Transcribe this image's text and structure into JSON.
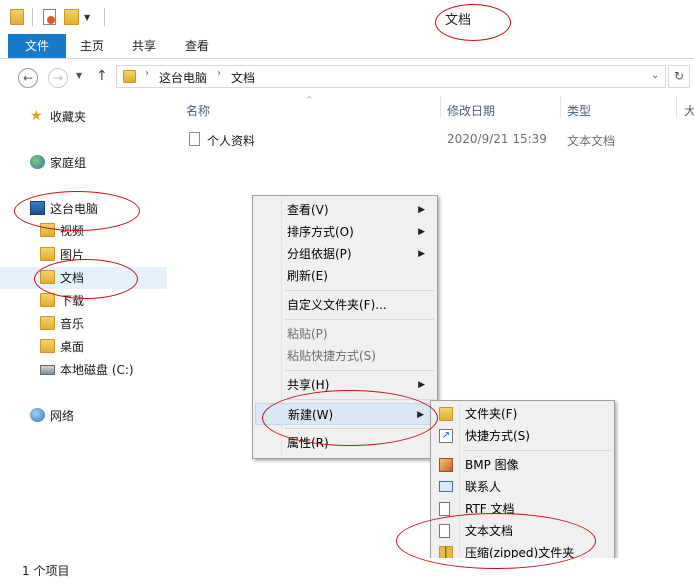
{
  "window": {
    "title": "文档"
  },
  "ribbon": {
    "tabs": [
      "文件",
      "主页",
      "共享",
      "查看"
    ]
  },
  "address": {
    "path": [
      "这台电脑",
      "文档"
    ],
    "refresh_icon": "refresh-icon"
  },
  "nav": {
    "favorites": "收藏夹",
    "homegroup": "家庭组",
    "this_pc": "这台电脑",
    "children": [
      "视频",
      "图片",
      "文档",
      "下载",
      "音乐",
      "桌面",
      "本地磁盘 (C:)"
    ],
    "network": "网络"
  },
  "columns": {
    "name": "名称",
    "date": "修改日期",
    "type": "类型",
    "size": "大"
  },
  "files": [
    {
      "name": "个人资料",
      "date": "2020/9/21 15:39",
      "type": "文本文档"
    }
  ],
  "context_menu": {
    "items": [
      {
        "label": "查看(V)",
        "submenu": true,
        "disabled": false
      },
      {
        "label": "排序方式(O)",
        "submenu": true,
        "disabled": false
      },
      {
        "label": "分组依据(P)",
        "submenu": true,
        "disabled": false
      },
      {
        "label": "刷新(E)",
        "submenu": false,
        "disabled": false
      },
      {
        "label": "自定义文件夹(F)...",
        "submenu": false,
        "disabled": false
      },
      {
        "label": "粘贴(P)",
        "submenu": false,
        "disabled": true
      },
      {
        "label": "粘贴快捷方式(S)",
        "submenu": false,
        "disabled": true
      },
      {
        "label": "共享(H)",
        "submenu": true,
        "disabled": false
      },
      {
        "label": "新建(W)",
        "submenu": true,
        "disabled": false,
        "highlighted": true
      },
      {
        "label": "属性(R)",
        "submenu": false,
        "disabled": false
      }
    ]
  },
  "new_submenu": {
    "items": [
      {
        "label": "文件夹(F)",
        "icon": "folder-icon"
      },
      {
        "label": "快捷方式(S)",
        "icon": "shortcut-icon"
      },
      {
        "label": "BMP 图像",
        "icon": "bmp-image-icon"
      },
      {
        "label": "联系人",
        "icon": "contact-icon"
      },
      {
        "label": "RTF 文档",
        "icon": "rtf-document-icon"
      },
      {
        "label": "文本文档",
        "icon": "text-document-icon"
      },
      {
        "label": "压缩(zipped)文件夹",
        "icon": "zip-folder-icon"
      }
    ]
  },
  "status": {
    "count": "1 个项目"
  },
  "colors": {
    "ribbon_file_tab": "#1979ca",
    "menu_bg": "#f0f0f0",
    "highlight": "#dbe7f5",
    "annotation": "#c81010",
    "selected_nav": "#e5f1fb"
  }
}
